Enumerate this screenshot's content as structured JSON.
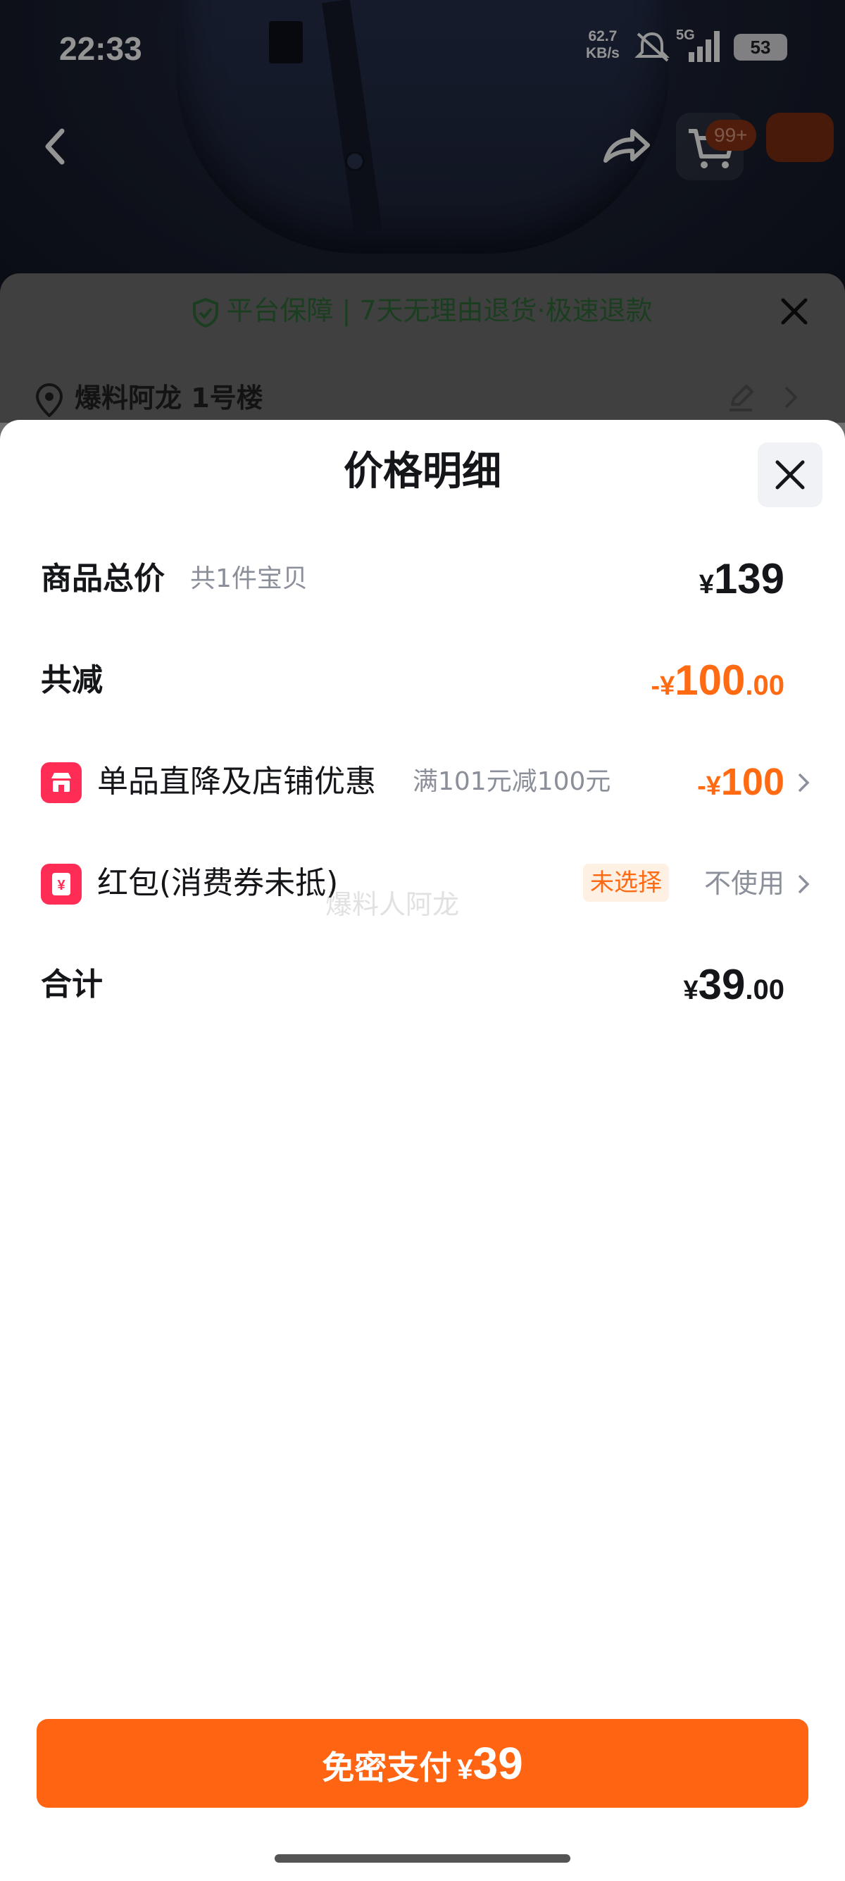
{
  "status_bar": {
    "time": "22:33",
    "net_speed_value": "62.7",
    "net_speed_unit": "KB/s",
    "network_type": "5G",
    "battery": "53"
  },
  "product_page": {
    "cart_badge": "99+",
    "guarantee_text": "平台保障 | 7天无理由退货·极速退款",
    "address": "爆料阿龙 1号楼"
  },
  "price_detail": {
    "title": "价格明细",
    "goods_total": {
      "label": "商品总价",
      "sub": "共1件宝贝",
      "yen": "¥",
      "amount": "139"
    },
    "total_discount": {
      "label": "共减",
      "prefix": "-¥",
      "amount_int": "100",
      "amount_dec": ".00"
    },
    "direct_discount": {
      "label": "单品直降及店铺优惠",
      "sub": "满101元减100元",
      "prefix": "-¥",
      "amount": "100"
    },
    "red_packet": {
      "label": "红包(消费券未抵)",
      "tag": "未选择",
      "value": "不使用"
    },
    "sum": {
      "label": "合计",
      "yen": "¥",
      "amount_int": "39",
      "amount_dec": ".00"
    },
    "watermark": "爆料人阿龙"
  },
  "pay_button": {
    "label": "免密支付",
    "yen": "¥",
    "amount": "39"
  },
  "colors": {
    "accent_orange": "#ff6412",
    "discount_orange": "#ff6a13",
    "icon_red": "#ff2c55",
    "guarantee_green": "#2f6b3a"
  }
}
